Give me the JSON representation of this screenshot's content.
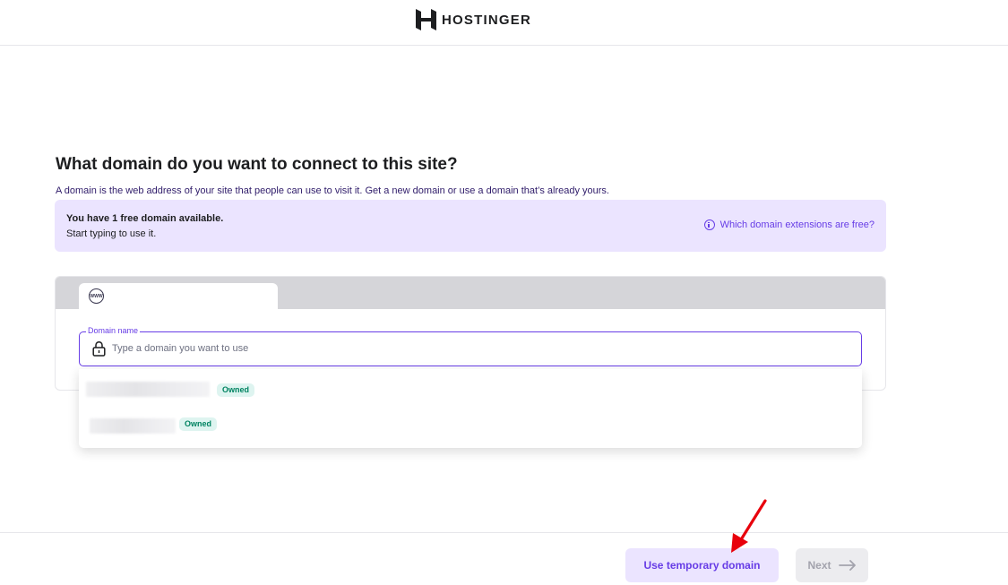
{
  "header": {
    "brand": "HOSTINGER",
    "logo_icon": "hostinger-logo-icon"
  },
  "main": {
    "title": "What domain do you want to connect to this site?",
    "subtitle": "A domain is the web address of your site that people can use to visit it. Get a new domain or use a domain that’s already yours.",
    "info": {
      "line1": "You have 1 free domain available.",
      "line2": "Start typing to use it.",
      "link": "Which domain extensions are free?",
      "link_icon": "info-icon"
    },
    "browser": {
      "tab_icon": "www-icon",
      "tab_icon_text": "WWW"
    },
    "domain_field": {
      "label": "Domain name",
      "placeholder": "Type a domain you want to use",
      "value": "",
      "icon": "lock-icon"
    },
    "suggestions": [
      {
        "badge": "Owned"
      },
      {
        "badge": "Owned"
      }
    ]
  },
  "footer": {
    "temp_button": "Use temporary domain",
    "next_button": "Next",
    "next_icon": "arrow-right-icon"
  },
  "colors": {
    "accent": "#673de6",
    "accent_light": "#ebe4ff",
    "owned_bg": "#def4f0",
    "owned_text": "#008361",
    "annotation": "#e8000c"
  }
}
